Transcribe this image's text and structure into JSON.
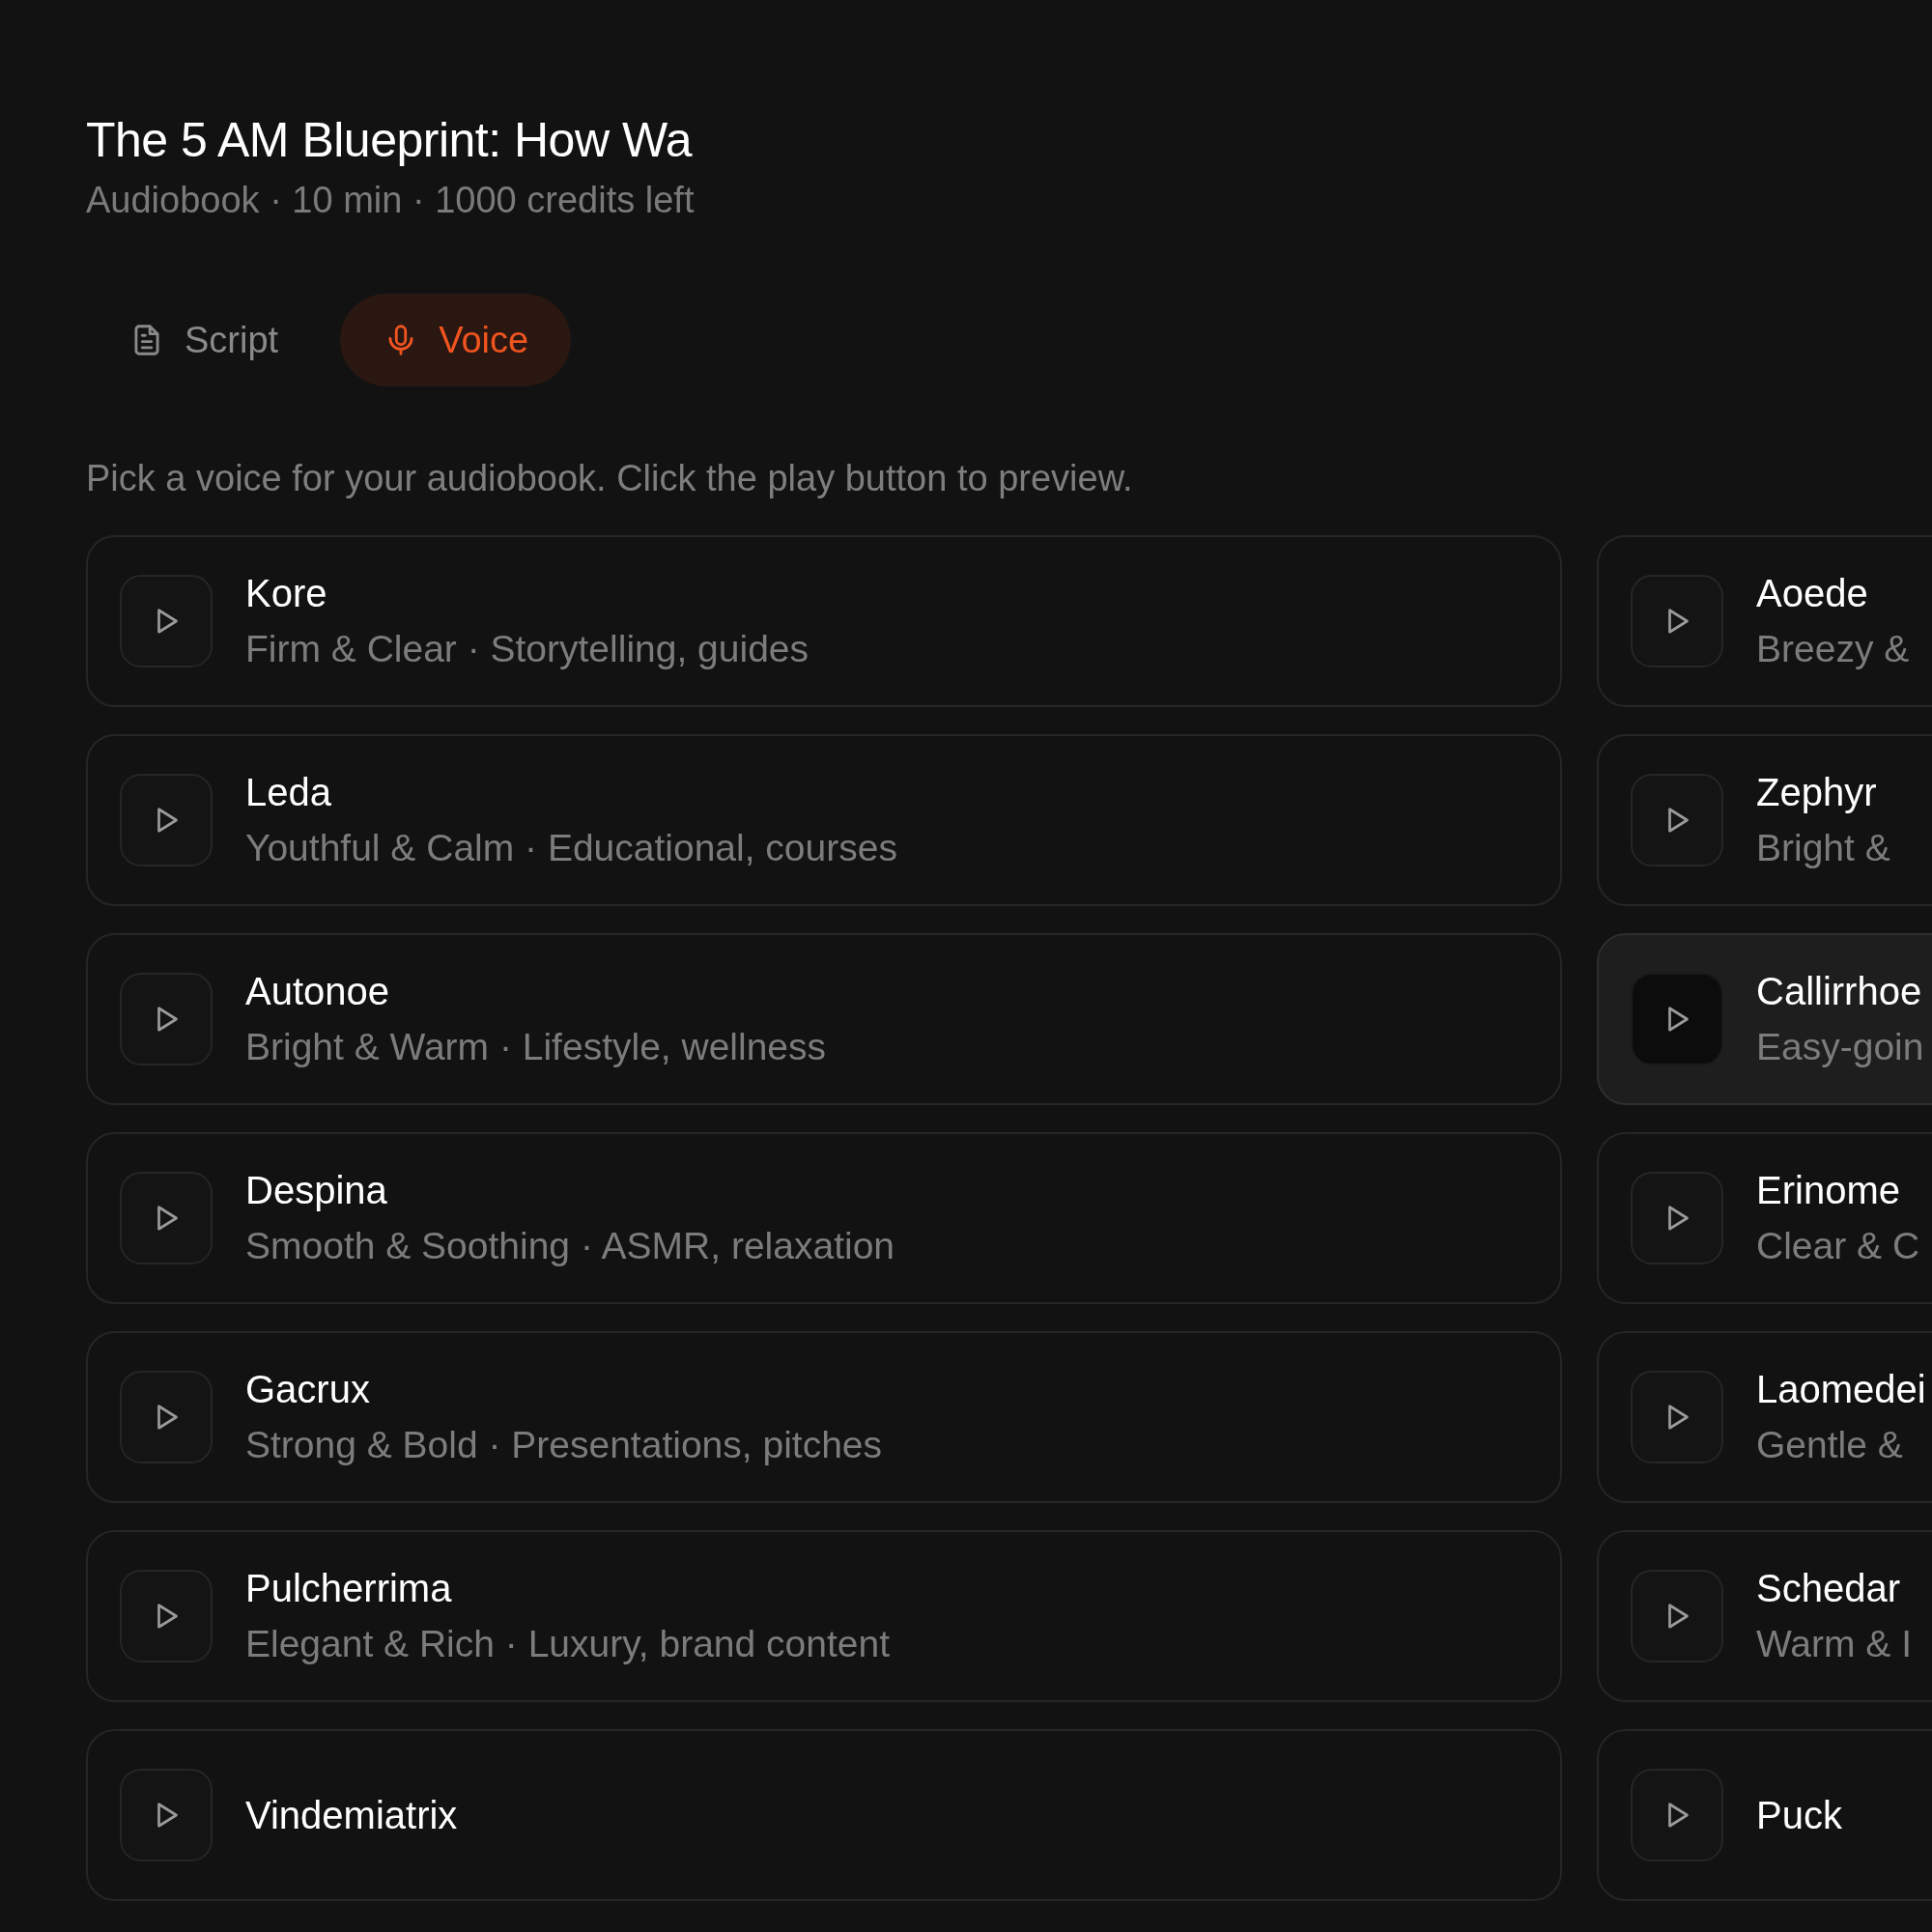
{
  "header": {
    "title": "The 5 AM Blueprint: How Wa",
    "subtitle": "Audiobook · 10 min · 1000 credits left"
  },
  "tabs": [
    {
      "label": "Script",
      "kind": "document",
      "selected": false
    },
    {
      "label": "Voice",
      "kind": "microphone",
      "selected": true
    }
  ],
  "instructions": "Pick a voice for your audiobook. Click the play button to preview.",
  "voices": [
    {
      "name": "Kore",
      "description": "Firm & Clear · Storytelling, guides",
      "selected": false
    },
    {
      "name": "Aoede",
      "description": "Breezy &",
      "selected": false
    },
    {
      "name": "Leda",
      "description": "Youthful & Calm · Educational, courses",
      "selected": false
    },
    {
      "name": "Zephyr",
      "description": "Bright &",
      "selected": false
    },
    {
      "name": "Autonoe",
      "description": "Bright & Warm · Lifestyle, wellness",
      "selected": false
    },
    {
      "name": "Callirrhoe",
      "description": "Easy-goin",
      "selected": true
    },
    {
      "name": "Despina",
      "description": "Smooth & Soothing · ASMR, relaxation",
      "selected": false
    },
    {
      "name": "Erinome",
      "description": "Clear & C",
      "selected": false
    },
    {
      "name": "Gacrux",
      "description": "Strong & Bold · Presentations, pitches",
      "selected": false
    },
    {
      "name": "Laomedei",
      "description": "Gentle &",
      "selected": false
    },
    {
      "name": "Pulcherrima",
      "description": "Elegant & Rich · Luxury, brand content",
      "selected": false
    },
    {
      "name": "Schedar",
      "description": "Warm & I",
      "selected": false
    },
    {
      "name": "Vindemiatrix",
      "selected": false
    },
    {
      "name": "Puck",
      "selected": false
    }
  ]
}
